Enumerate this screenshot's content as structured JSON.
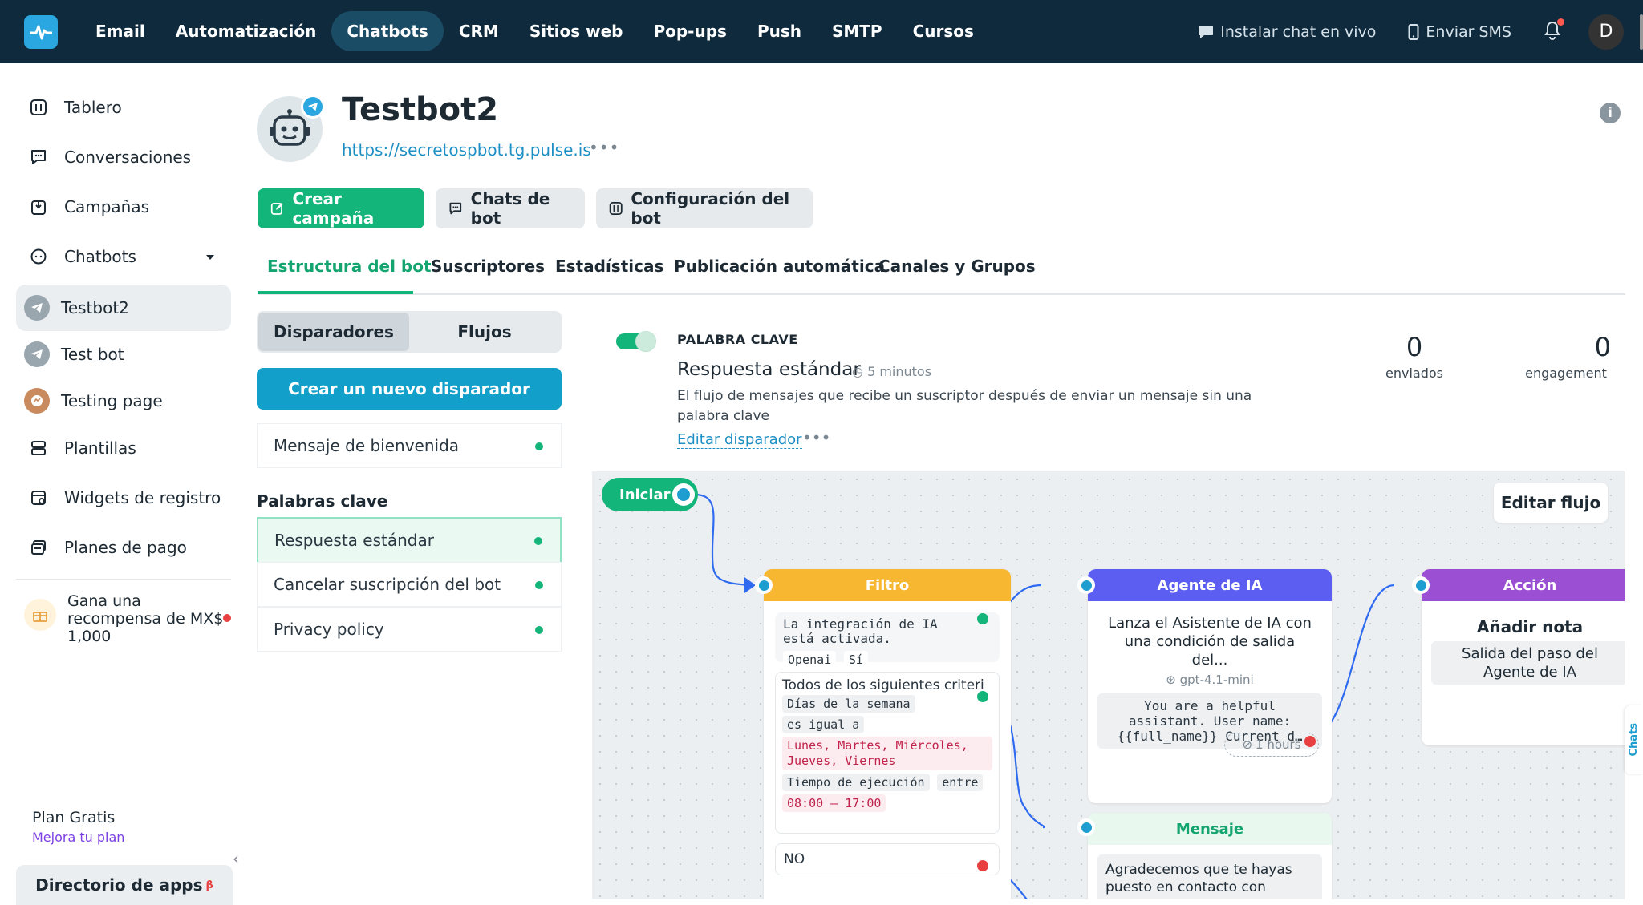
{
  "nav": {
    "items": [
      "Email",
      "Automatización",
      "Chatbots",
      "CRM",
      "Sitios web",
      "Pop-ups",
      "Push",
      "SMTP",
      "Cursos"
    ],
    "active_index": 2,
    "install_chat": "Instalar chat en vivo",
    "send_sms": "Enviar SMS",
    "avatar_letter": "D"
  },
  "sidebar": {
    "items": [
      "Tablero",
      "Conversaciones",
      "Campañas",
      "Chatbots"
    ],
    "bots": [
      "Testbot2",
      "Test bot",
      "Testing page"
    ],
    "items2": [
      "Plantillas",
      "Widgets de registro",
      "Planes de pago"
    ],
    "reward": "Gana una recompensa de MX$ 1,000",
    "plan": "Plan Gratis",
    "upgrade": "Mejora tu plan",
    "app_dir": "Directorio de apps",
    "beta": "β"
  },
  "header": {
    "bot_name": "Testbot2",
    "bot_link": "https://secretospbot.tg.pulse.is",
    "more": "•••"
  },
  "buttons": {
    "create_campaign": "Crear campaña",
    "bot_chats": "Chats de bot",
    "bot_config": "Configuración del bot"
  },
  "tabs": [
    "Estructura del bot",
    "Suscriptores",
    "Estadísticas",
    "Publicación automática",
    "Canales y Grupos"
  ],
  "left": {
    "seg_triggers": "Disparadores",
    "seg_flows": "Flujos",
    "new_trigger": "Crear un nuevo disparador",
    "welcome": "Mensaje de bienvenida",
    "keywords_title": "Palabras clave",
    "keywords": [
      "Respuesta estándar",
      "Cancelar suscripción del bot",
      "Privacy policy"
    ]
  },
  "trigger": {
    "label": "PALABRA CLAVE",
    "title": "Respuesta estándar",
    "time": "5 minutos",
    "desc": "El flujo de mensajes que recibe un suscriptor después de enviar un mensaje sin una palabra clave",
    "edit": "Editar disparador",
    "sent_value": "0",
    "sent_label": "enviados",
    "eng_value": "0",
    "eng_label": "engagement"
  },
  "flow": {
    "start": "Iniciar",
    "edit_flow": "Editar flujo",
    "filter": {
      "title": "Filtro",
      "cond1_text": "La integración de IA está activada.",
      "cond1_chip1": "Openai",
      "cond1_chip2": "Sí",
      "cond2_text": "Todos de los siguientes criteri",
      "cond2_chip1": "Días de la semana",
      "cond2_chip2": "es igual a",
      "cond2_days": "Lunes, Martes, Miércoles, Jueves, Viernes",
      "cond2_chip3": "Tiempo de ejecución",
      "cond2_chip4": "entre",
      "cond2_time": "08:00 — 17:00",
      "no": "NO"
    },
    "agent": {
      "title": "Agente de IA",
      "desc": "Lanza el Asistente de IA con una condición de salida del...",
      "model": "gpt-4.1-mini",
      "prompt": "You are a helpful assistant. User name: {{full_name}} Current d…",
      "timeout": "1 hours"
    },
    "message": {
      "title": "Mensaje",
      "text": "Agradecemos que te hayas puesto en contacto con"
    },
    "action": {
      "title": "Acción",
      "name": "Añadir nota",
      "desc": "Salida del paso del Agente de IA"
    },
    "chats_tab": "Chats"
  },
  "colors": {
    "topbar": "#0f2a3d",
    "accent_green": "#13b57a",
    "accent_blue": "#129fc9",
    "filter_header": "#f7b731",
    "agent_header": "#5b5ef0",
    "action_header": "#9b4fd2",
    "message_header": "#e8f8ef"
  }
}
